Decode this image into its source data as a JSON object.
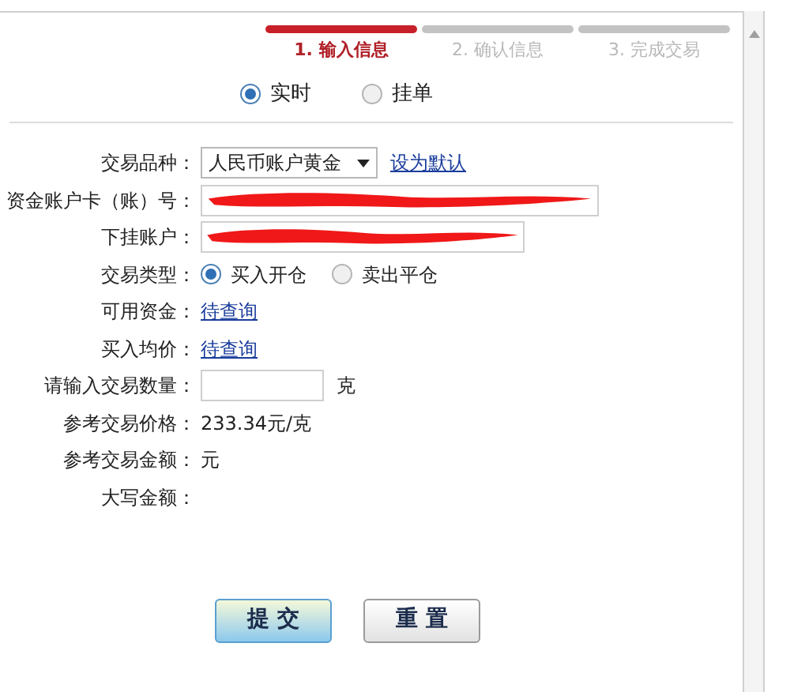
{
  "steps": [
    {
      "label": "1. 输入信息",
      "selected": true
    },
    {
      "label": "2. 确认信息",
      "selected": false
    },
    {
      "label": "3. 完成交易",
      "selected": false
    }
  ],
  "modes": [
    {
      "label": "实时",
      "selected": true
    },
    {
      "label": "挂单",
      "selected": false
    }
  ],
  "form": [
    {
      "kind": "select",
      "label": "交易品种：",
      "value": "人民币账户黄金",
      "link": "设为默认"
    },
    {
      "kind": "redacted",
      "label": "资金账户卡（账）号："
    },
    {
      "kind": "redacted",
      "label": "下挂账户："
    },
    {
      "kind": "radio",
      "label": "交易类型：",
      "options": [
        {
          "label": "买入开仓",
          "selected": true
        },
        {
          "label": "卖出平仓",
          "selected": false
        }
      ]
    },
    {
      "kind": "link",
      "label": "可用资金：",
      "value": "待查询"
    },
    {
      "kind": "link",
      "label": "买入均价：",
      "value": "待查询"
    },
    {
      "kind": "input",
      "label": "请输入交易数量：",
      "unit": "克"
    },
    {
      "kind": "text",
      "label": "参考交易价格：",
      "value": "233.34元/克"
    },
    {
      "kind": "text",
      "label": "参考交易金额：",
      "value": "元"
    },
    {
      "kind": "text",
      "label": "大写金额："
    }
  ],
  "buttons": [
    {
      "label": "提 交",
      "kind": "primary"
    },
    {
      "label": "重 置",
      "kind": "secondary"
    }
  ]
}
